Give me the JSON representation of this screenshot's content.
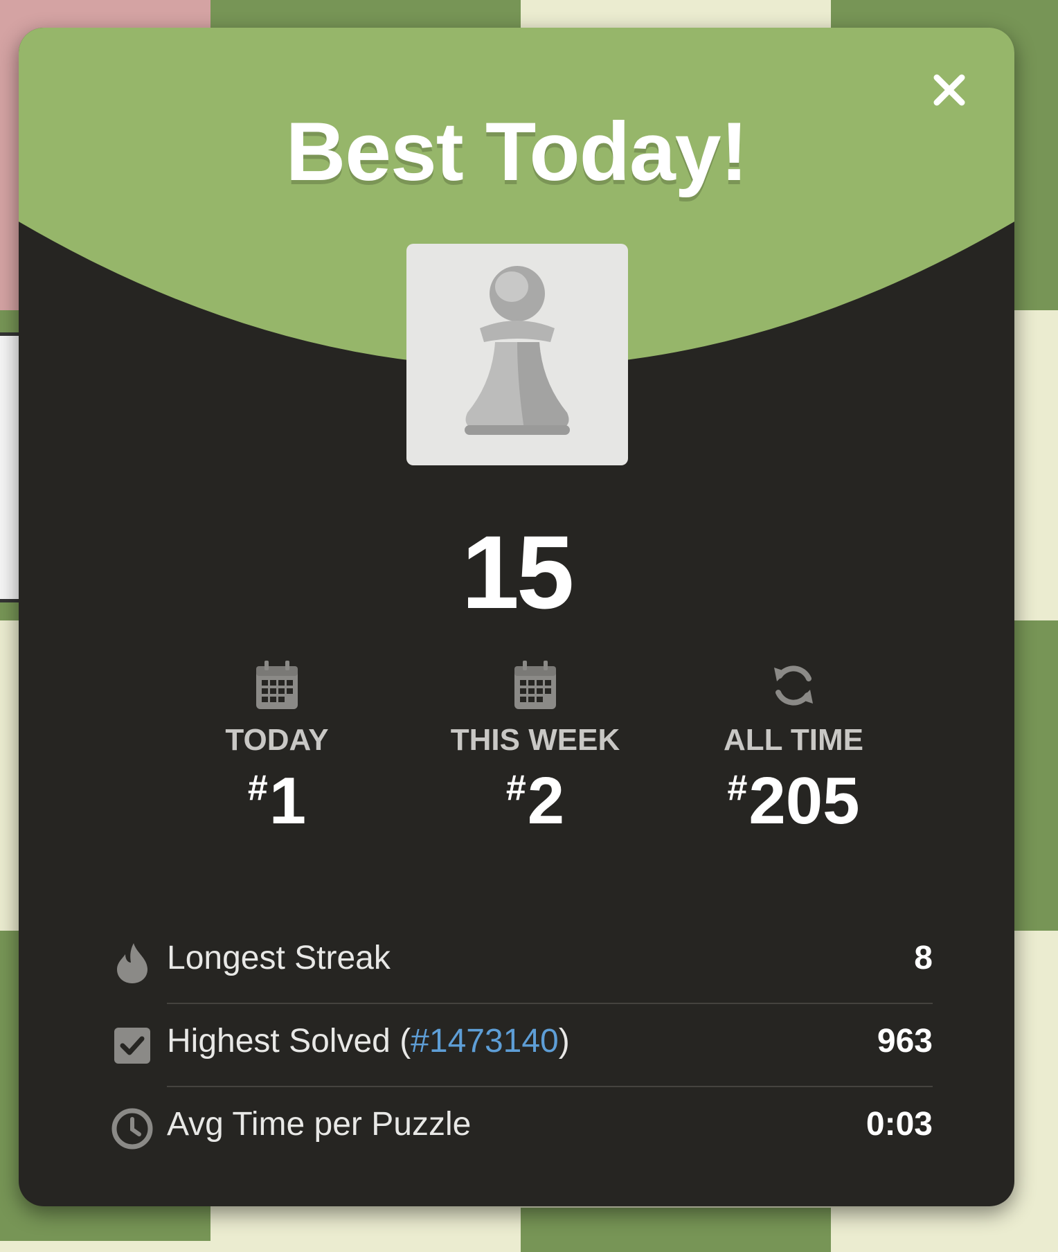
{
  "modal": {
    "title": "Best Today!",
    "score": "15",
    "colors": {
      "header_green": "#96b66a",
      "body_dark": "#262522",
      "link_blue": "#5e9ed6"
    }
  },
  "stats": [
    {
      "icon": "calendar-icon",
      "label": "TODAY",
      "rank_symbol": "#",
      "rank": "1"
    },
    {
      "icon": "calendar-icon",
      "label": "THIS WEEK",
      "rank_symbol": "#",
      "rank": "2"
    },
    {
      "icon": "refresh-icon",
      "label": "ALL TIME",
      "rank_symbol": "#",
      "rank": "205"
    }
  ],
  "rows": {
    "streak": {
      "icon": "flame-icon",
      "label": "Longest Streak",
      "value": "8"
    },
    "highest": {
      "icon": "checkbox-icon",
      "label_prefix": "Highest Solved (",
      "link": "#1473140",
      "label_suffix": ")",
      "value": "963"
    },
    "avg_time": {
      "icon": "clock-icon",
      "label": "Avg Time per Puzzle",
      "value": "0:03"
    }
  }
}
